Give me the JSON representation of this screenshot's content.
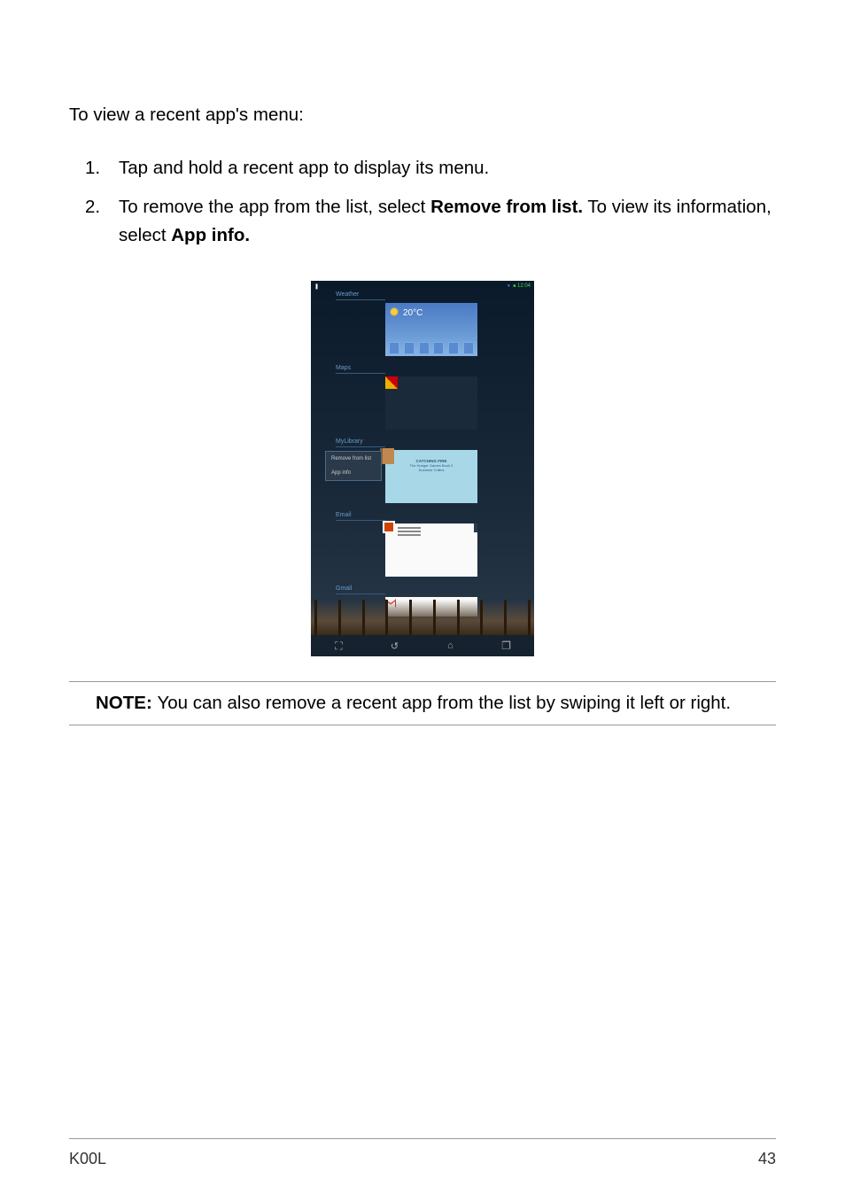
{
  "intro": "To view a recent app's menu:",
  "list": {
    "item1": {
      "num": "1.",
      "text": "Tap and hold a recent app to display its menu."
    },
    "item2": {
      "num": "2.",
      "text_pre": "To remove the app from the list, select ",
      "bold1": "Remove from list.",
      "text_mid": " To view its information, select ",
      "bold2": "App info."
    }
  },
  "screenshot": {
    "status": {
      "left": "❚",
      "wifi": "▾",
      "battery": "■",
      "time": "12:04"
    },
    "recents": {
      "weather": {
        "label": "Weather",
        "temp": "20°C"
      },
      "maps": {
        "label": "Maps"
      },
      "mylibrary": {
        "label": "MyLibrary",
        "book_title": "CATCHING FIRE",
        "book_sub1": "The Hunger Games Book 2",
        "book_sub2": "Suzanne Collins",
        "menu": {
          "remove": "Remove from list",
          "appinfo": "App info"
        }
      },
      "email": {
        "label": "Email"
      },
      "gmail": {
        "label": "Gmail"
      }
    },
    "nav": {
      "screenshot": "⛶",
      "back": "↺",
      "home": "⌂",
      "recent": "❐"
    }
  },
  "note": {
    "label": "NOTE:  ",
    "text": "You can also remove a recent app from the list by swiping it left or right."
  },
  "footer": {
    "left": "K00L",
    "right": "43"
  }
}
